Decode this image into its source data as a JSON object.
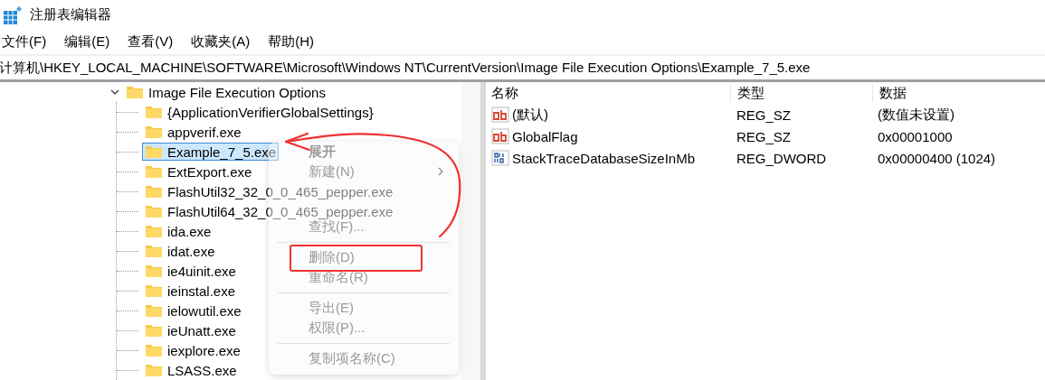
{
  "window": {
    "title": "注册表编辑器"
  },
  "menu_bar": [
    "文件(F)",
    "编辑(E)",
    "查看(V)",
    "收藏夹(A)",
    "帮助(H)"
  ],
  "address_bar": {
    "path": "计算机\\HKEY_LOCAL_MACHINE\\SOFTWARE\\Microsoft\\Windows NT\\CurrentVersion\\Image File Execution Options\\Example_7_5.exe"
  },
  "tree": {
    "label": "Image File Execution Options",
    "expanded": true,
    "children": [
      {
        "label": "{ApplicationVerifierGlobalSettings}",
        "selected": false
      },
      {
        "label": "appverif.exe",
        "selected": false
      },
      {
        "label": "Example_7_5.exe",
        "selected": true
      },
      {
        "label": "ExtExport.exe",
        "selected": false
      },
      {
        "label": "FlashUtil32_32_0_0_465_pepper.exe",
        "selected": false
      },
      {
        "label": "FlashUtil64_32_0_0_465_pepper.exe",
        "selected": false
      },
      {
        "label": "ida.exe",
        "selected": false
      },
      {
        "label": "idat.exe",
        "selected": false
      },
      {
        "label": "ie4uinit.exe",
        "selected": false
      },
      {
        "label": "ieinstal.exe",
        "selected": false
      },
      {
        "label": "ielowutil.exe",
        "selected": false
      },
      {
        "label": "ieUnatt.exe",
        "selected": false
      },
      {
        "label": "iexplore.exe",
        "selected": false
      },
      {
        "label": "LSASS.exe",
        "selected": false
      }
    ]
  },
  "values": {
    "columns": [
      "名称",
      "类型",
      "数据"
    ],
    "rows": [
      {
        "kind": "string",
        "name": "(默认)",
        "type": "REG_SZ",
        "data": "(数值未设置)"
      },
      {
        "kind": "string",
        "name": "GlobalFlag",
        "type": "REG_SZ",
        "data": "0x00001000"
      },
      {
        "kind": "binary",
        "name": "StackTraceDatabaseSizeInMb",
        "type": "REG_DWORD",
        "data": "0x00000400 (1024)"
      }
    ]
  },
  "context_menu": {
    "items": [
      {
        "kind": "item",
        "label": "展开",
        "disabled": true,
        "default": true,
        "submenu": false
      },
      {
        "kind": "item",
        "label": "新建(N)",
        "disabled": true,
        "default": false,
        "submenu": true
      },
      {
        "kind": "item",
        "label": "查找(F)...",
        "disabled": true,
        "default": false,
        "submenu": false
      },
      {
        "kind": "separator"
      },
      {
        "kind": "item",
        "label": "删除(D)",
        "disabled": true,
        "default": false,
        "submenu": false
      },
      {
        "kind": "item",
        "label": "重命名(R)",
        "disabled": true,
        "default": false,
        "submenu": false
      },
      {
        "kind": "separator"
      },
      {
        "kind": "item",
        "label": "导出(E)",
        "disabled": true,
        "default": false,
        "submenu": false
      },
      {
        "kind": "item",
        "label": "权限(P)...",
        "disabled": true,
        "default": false,
        "submenu": false
      },
      {
        "kind": "separator"
      },
      {
        "kind": "item",
        "label": "复制项名称(C)",
        "disabled": true,
        "default": false,
        "submenu": false
      }
    ]
  }
}
